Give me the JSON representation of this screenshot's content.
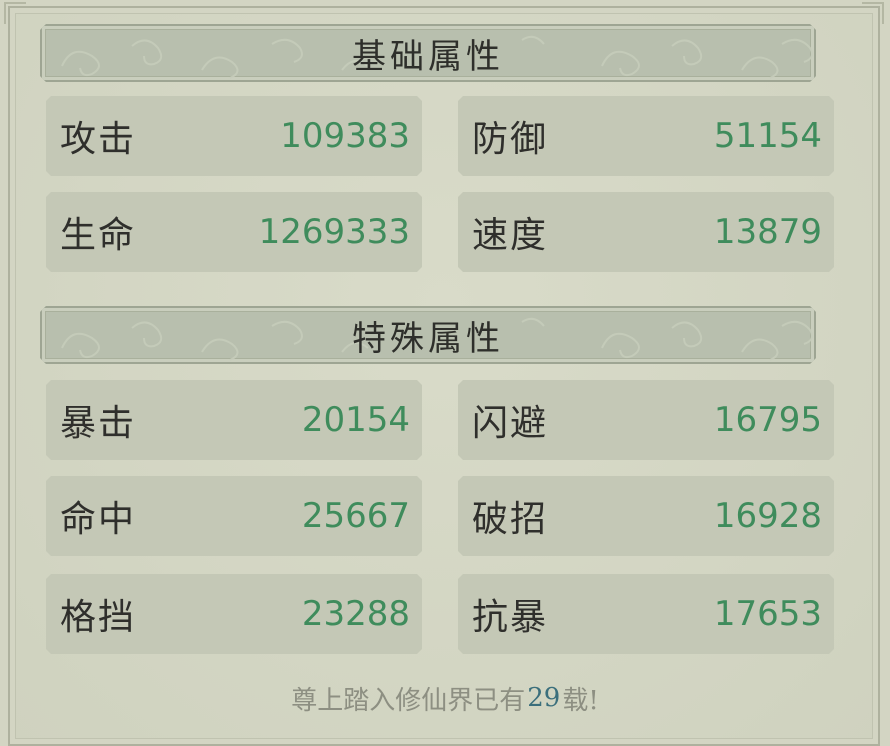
{
  "sections": [
    {
      "title": "基础属性",
      "stats": [
        {
          "label": "攻击",
          "value": "109383"
        },
        {
          "label": "防御",
          "value": "51154"
        },
        {
          "label": "生命",
          "value": "1269333"
        },
        {
          "label": "速度",
          "value": "13879"
        }
      ]
    },
    {
      "title": "特殊属性",
      "stats": [
        {
          "label": "暴击",
          "value": "20154"
        },
        {
          "label": "闪避",
          "value": "16795"
        },
        {
          "label": "命中",
          "value": "25667"
        },
        {
          "label": "破招",
          "value": "16928"
        },
        {
          "label": "格挡",
          "value": "23288"
        },
        {
          "label": "抗暴",
          "value": "17653"
        }
      ]
    }
  ],
  "footer": {
    "prefix": "尊上踏入修仙界已有",
    "years": "29",
    "suffix": "载!"
  },
  "colors": {
    "background": "#d3d5c3",
    "value_text": "#3f8c5c",
    "label_text": "#2f2f2c",
    "footer_text": "#8d8f82",
    "footer_number": "#3b6f7c"
  }
}
